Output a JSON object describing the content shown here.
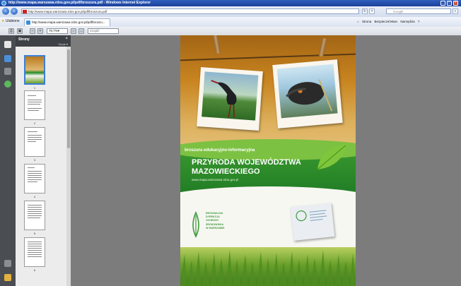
{
  "window": {
    "title": "http://www.mapa.warszawa.rdos.gov.pl/pdf/broszura.pdf - Windows Internet Explorer"
  },
  "address_bar": {
    "url": "http://www.mapa.warszawa.rdos.gov.pl/pdf/broszura.pdf",
    "search_placeholder": "Google"
  },
  "tab_bar": {
    "favorites_label": "Ulubione",
    "tab_title": "http://www.mapa.warszawa.rdos.gov.pl/pdf/broszu...",
    "commands": [
      "Strona",
      "Bezpieczeństwo",
      "Narzędzia"
    ]
  },
  "pdf_toolbar": {
    "zoom": "70,7%",
    "find_placeholder": "Znajdź"
  },
  "pages_panel": {
    "title": "Strony",
    "options_label": "Opcje",
    "thumbnails": [
      {
        "number": "1"
      },
      {
        "number": "2"
      },
      {
        "number": "3"
      },
      {
        "number": "4"
      },
      {
        "number": "5"
      },
      {
        "number": "6"
      }
    ]
  },
  "document": {
    "subtitle": "broszura edukacyjno-informacyjna",
    "title_line1": "PRZYRODA WOJEWÓDZTWA",
    "title_line2": "MAZOWIECKIEGO",
    "url": "www.mapa.warszawa.rdos.gov.pl",
    "logo_text_lines": [
      "REGIONALNA",
      "DYREKCJA",
      "OCHRONY",
      "ŚRODOWISKA",
      "W WARSZAWIE"
    ]
  },
  "colors": {
    "titlebar": "#1b3f9a",
    "green_band": "#2a8a2a",
    "viewer_bg": "#7c7c7c"
  }
}
